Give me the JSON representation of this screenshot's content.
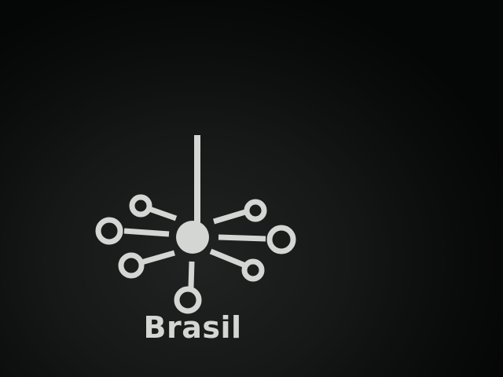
{
  "scene": {
    "background_color": "#0d0f0f",
    "emblem_color": "#d4d6d3",
    "emblem_icon": "network-hub-icon",
    "caption": "Brasil"
  }
}
